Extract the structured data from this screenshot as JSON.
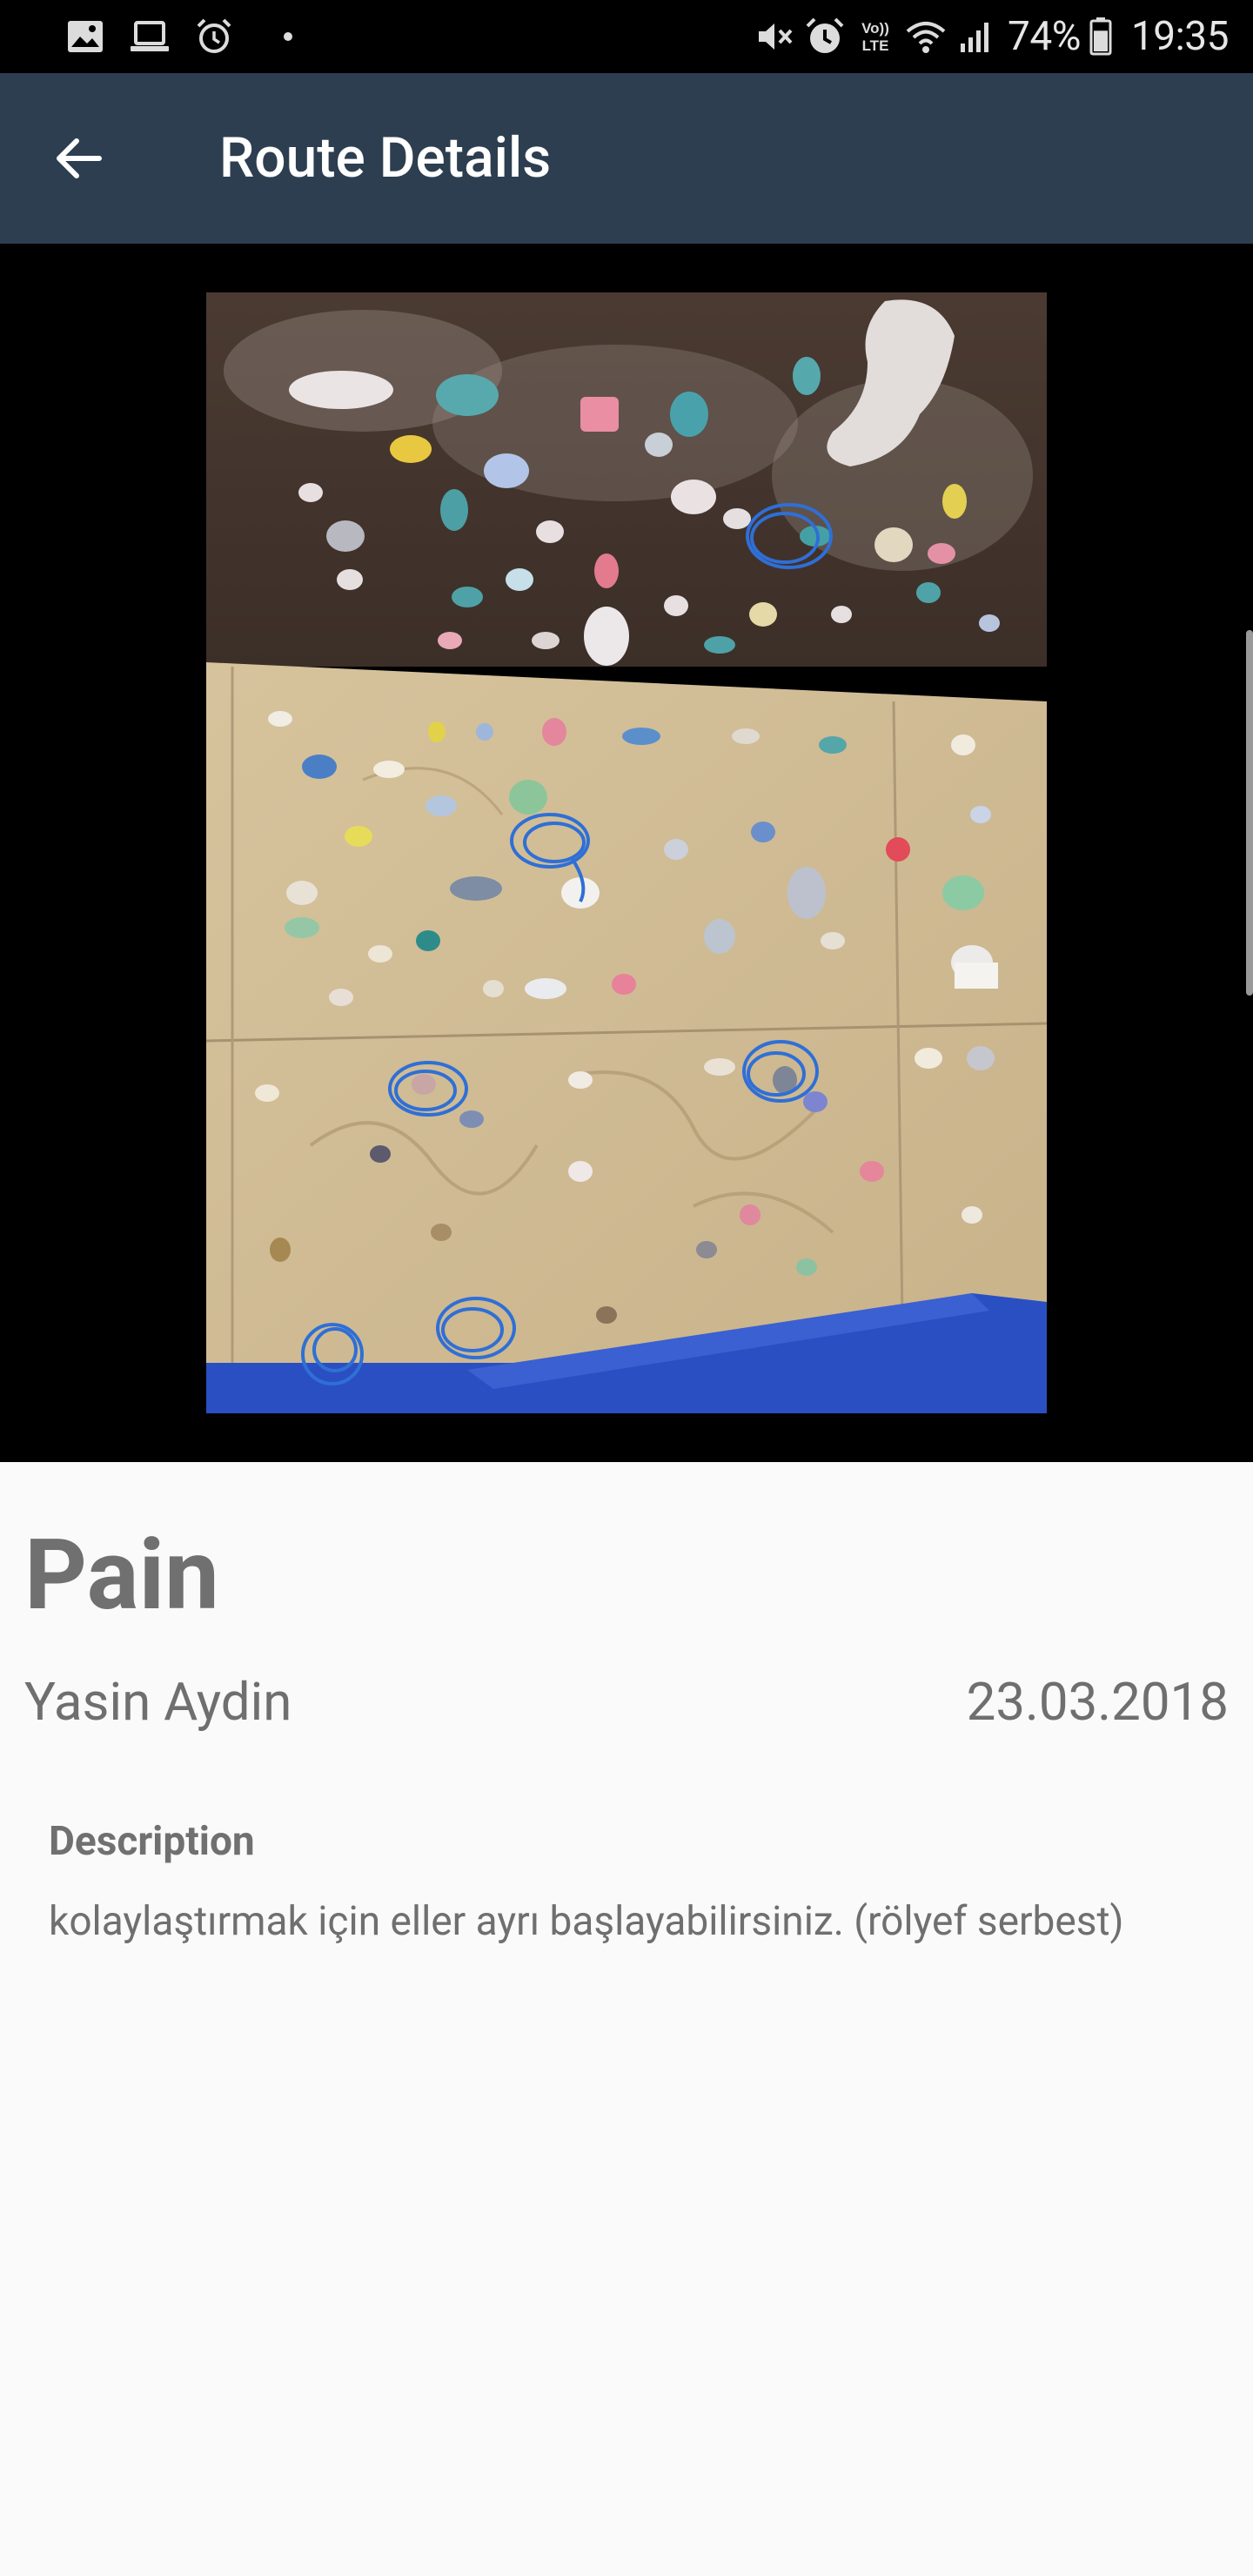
{
  "status_bar": {
    "left_icons": [
      "image-icon",
      "laptop-icon",
      "alarm-icon",
      "dot-icon"
    ],
    "right_icons": [
      "mute-icon",
      "alarm-icon",
      "volte-icon",
      "wifi-icon",
      "signal-icon"
    ],
    "volte_label_top": "Vo))",
    "volte_label_bottom": "LTE",
    "battery_percent": "74%",
    "battery_level": 0.74,
    "time": "19:35"
  },
  "app_bar": {
    "back_icon": "arrow-left-icon",
    "title": "Route Details",
    "background": "#2d3e50"
  },
  "route": {
    "image_description": "climbing-wall-photo",
    "name": "Pain",
    "setter": "Yasin Aydin",
    "date": "23.03.2018",
    "description_label": "Description",
    "description": "kolaylaştırmak için eller ayrı başlayabilirsiniz. (rölyef serbest)"
  },
  "colors": {
    "background": "#fafafa",
    "primary_text": "#707070",
    "marker": "#2f6fd6",
    "mat": "#2a4fc2"
  }
}
